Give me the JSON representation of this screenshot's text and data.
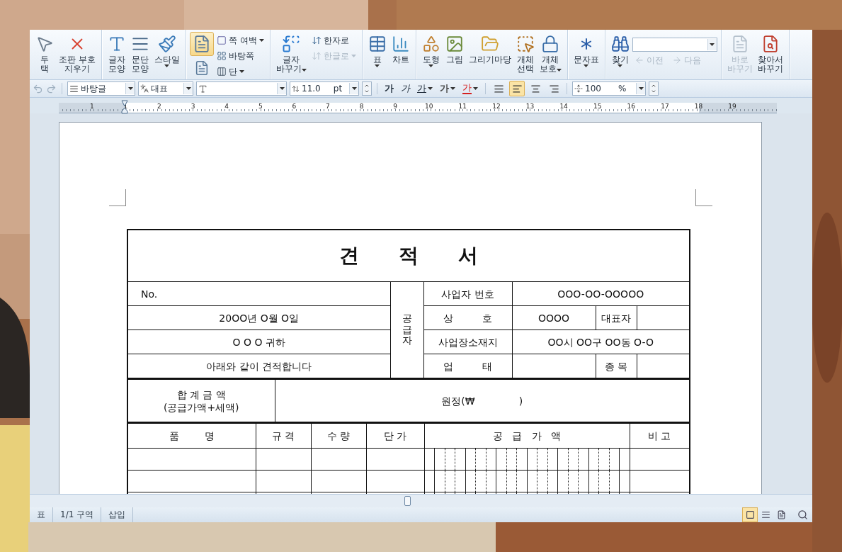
{
  "ribbon": {
    "groups": [
      {
        "items": [
          {
            "kind": "large",
            "label": "두\n택",
            "caret": false,
            "disabled": false
          },
          {
            "kind": "large",
            "label": "조판 부호\n지우기",
            "caret": false,
            "disabled": false
          }
        ]
      },
      {
        "items": [
          {
            "kind": "large",
            "label": "글자\n모양",
            "caret": false,
            "disabled": false
          },
          {
            "kind": "large",
            "label": "문단\n모양",
            "caret": false,
            "disabled": false
          },
          {
            "kind": "large",
            "label": "스타일",
            "caret": true,
            "disabled": false
          }
        ]
      },
      {
        "items": [
          {
            "kind": "icon",
            "selected": true,
            "disabled": false
          },
          {
            "kind": "icon",
            "selected": false,
            "disabled": false
          },
          {
            "kind": "small",
            "label": "쪽 여백",
            "caret": true,
            "disabled": false
          },
          {
            "kind": "small",
            "label": "바탕쪽",
            "caret": false,
            "disabled": false
          },
          {
            "kind": "small",
            "label": "단",
            "caret": true,
            "disabled": false
          }
        ]
      },
      {
        "items": [
          {
            "kind": "large",
            "label": "글자\n바꾸기",
            "caret": true,
            "disabled": false
          },
          {
            "kind": "small",
            "label": "한자로",
            "caret": false,
            "disabled": false
          },
          {
            "kind": "small",
            "label": "한글로",
            "caret": true,
            "disabled": true
          }
        ]
      },
      {
        "items": [
          {
            "kind": "large",
            "label": "표",
            "caret": true,
            "disabled": false
          },
          {
            "kind": "large",
            "label": "차트",
            "caret": false,
            "disabled": false
          }
        ]
      },
      {
        "items": [
          {
            "kind": "large",
            "label": "도형",
            "caret": true,
            "disabled": false
          },
          {
            "kind": "large",
            "label": "그림",
            "caret": false,
            "disabled": false
          },
          {
            "kind": "large",
            "label": "그리기마당",
            "caret": false,
            "disabled": false
          },
          {
            "kind": "large",
            "label": "개체\n선택",
            "caret": false,
            "disabled": false
          },
          {
            "kind": "large",
            "label": "개체\n보호",
            "caret": true,
            "disabled": false
          }
        ]
      },
      {
        "items": [
          {
            "kind": "large",
            "label": "문자표",
            "caret": true,
            "disabled": false
          }
        ]
      },
      {
        "items": [
          {
            "kind": "large",
            "label": "찾기",
            "caret": true,
            "disabled": false
          },
          {
            "kind": "combo"
          },
          {
            "kind": "nav",
            "label": "이전",
            "disabled": true
          },
          {
            "kind": "nav",
            "label": "다음",
            "disabled": true
          }
        ]
      },
      {
        "items": [
          {
            "kind": "large",
            "label": "바로\n바꾸기",
            "caret": false,
            "disabled": true
          },
          {
            "kind": "large",
            "label": "찾아서\n바꾸기",
            "caret": false,
            "disabled": false
          }
        ]
      }
    ]
  },
  "format_bar": {
    "style": "바탕글",
    "language": "대표",
    "size": "11.0",
    "size_unit": "pt",
    "char_buttons": [
      {
        "kind": "bold",
        "label": "가",
        "caret": false
      },
      {
        "kind": "italic",
        "label": "가",
        "caret": false
      },
      {
        "kind": "underline",
        "label": "가",
        "caret": true
      },
      {
        "kind": "outline",
        "label": "가",
        "caret": true
      },
      {
        "kind": "color",
        "label": "가",
        "caret": true,
        "color": "#d42020"
      }
    ],
    "align": [
      {
        "selected": false
      },
      {
        "selected": true
      },
      {
        "selected": false
      },
      {
        "selected": false
      }
    ],
    "line_spacing": "100",
    "line_spacing_unit": "%"
  },
  "ruler": {
    "numbers": [
      "1",
      "1",
      "2",
      "3",
      "4",
      "5",
      "6",
      "7",
      "8",
      "9",
      "10",
      "11",
      "12",
      "13",
      "14",
      "15",
      "16",
      "17",
      "18",
      "19"
    ]
  },
  "document": {
    "title": "견 적 서",
    "supplier_label": "공급자",
    "info_rows": [
      {
        "left": "No.",
        "left_aligned": true,
        "label": "사업자 번호",
        "value": "OOO-OO-OOOOO"
      },
      {
        "left": "20OO년 O월 O일",
        "left_aligned": false,
        "label": "상         호",
        "value": "OOOO",
        "label2": "대표자"
      },
      {
        "left": "O O O 귀하",
        "left_aligned": false,
        "label": "사업장소재지",
        "value": "OO시 OO구 OO동 O-O"
      },
      {
        "left": "아래와 같이 견적합니다",
        "left_aligned": false,
        "label": "업         태",
        "label2": "종 목"
      }
    ],
    "total": {
      "label": "합 계 금 액",
      "sublabel": "(공급가액+세액)",
      "amount": "원정(₩              )"
    },
    "item_headers": [
      "품        명",
      "규 격",
      "수 량",
      "단 가",
      "공   급   가   액",
      "비 고"
    ]
  },
  "status_bar": {
    "items": [
      "표",
      "1/1 구역",
      "삽입"
    ],
    "views": [
      {
        "selected": true
      },
      {
        "selected": false
      },
      {
        "selected": false
      }
    ]
  }
}
